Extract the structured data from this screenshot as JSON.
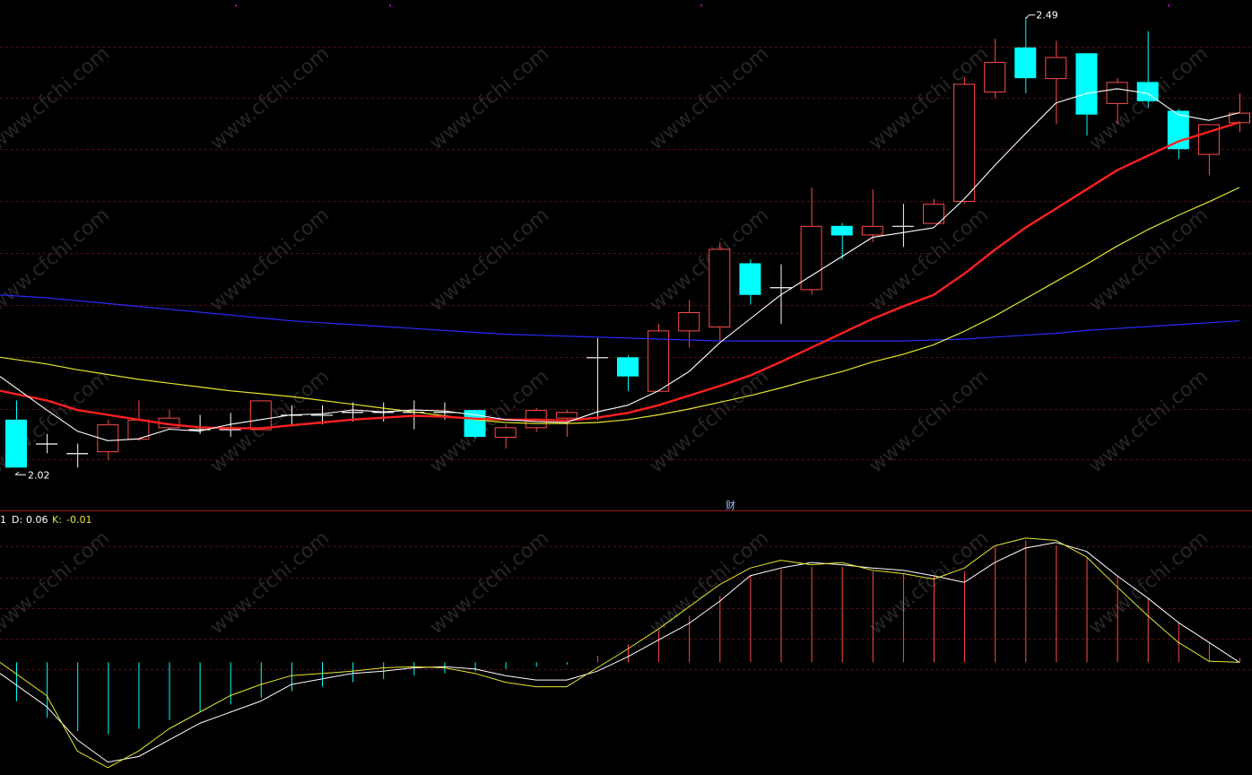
{
  "colors": {
    "background": "#000000",
    "grid": "#5a0c0c",
    "divider": "#9a1a1a",
    "up": "#ff4a4a",
    "down": "#00ffff",
    "neutral": "#ffffff",
    "ma5": "#ffffff",
    "ma10": "#ff2020",
    "ma20": "#e6e62c",
    "ma60": "#2a2aff",
    "k_line": "#e6e62c",
    "d_line": "#ffffff",
    "top_markers": "#c000c0"
  },
  "chart_data": [
    {
      "type": "candlestick",
      "panel": "price",
      "grid": true,
      "ylim": [
        1.995,
        2.5
      ],
      "candles": [
        {
          "o": 2.07,
          "h": 2.09,
          "l": 2.02,
          "c": 2.02
        },
        {
          "o": 2.045,
          "h": 2.055,
          "l": 2.035,
          "c": 2.045
        },
        {
          "o": 2.035,
          "h": 2.045,
          "l": 2.02,
          "c": 2.035
        },
        {
          "o": 2.037,
          "h": 2.07,
          "l": 2.028,
          "c": 2.065
        },
        {
          "o": 2.05,
          "h": 2.09,
          "l": 2.048,
          "c": 2.07
        },
        {
          "o": 2.062,
          "h": 2.08,
          "l": 2.06,
          "c": 2.072
        },
        {
          "o": 2.06,
          "h": 2.075,
          "l": 2.055,
          "c": 2.06
        },
        {
          "o": 2.06,
          "h": 2.077,
          "l": 2.052,
          "c": 2.06
        },
        {
          "o": 2.06,
          "h": 2.085,
          "l": 2.06,
          "c": 2.09
        },
        {
          "o": 2.075,
          "h": 2.085,
          "l": 2.065,
          "c": 2.075
        },
        {
          "o": 2.075,
          "h": 2.085,
          "l": 2.065,
          "c": 2.075
        },
        {
          "o": 2.078,
          "h": 2.088,
          "l": 2.068,
          "c": 2.078
        },
        {
          "o": 2.078,
          "h": 2.088,
          "l": 2.068,
          "c": 2.078
        },
        {
          "o": 2.078,
          "h": 2.09,
          "l": 2.06,
          "c": 2.078
        },
        {
          "o": 2.078,
          "h": 2.088,
          "l": 2.07,
          "c": 2.078
        },
        {
          "o": 2.08,
          "h": 2.08,
          "l": 2.05,
          "c": 2.052
        },
        {
          "o": 2.052,
          "h": 2.065,
          "l": 2.04,
          "c": 2.062
        },
        {
          "o": 2.062,
          "h": 2.082,
          "l": 2.057,
          "c": 2.08
        },
        {
          "o": 2.072,
          "h": 2.08,
          "l": 2.052,
          "c": 2.078
        },
        {
          "o": 2.135,
          "h": 2.155,
          "l": 2.07,
          "c": 2.135
        },
        {
          "o": 2.135,
          "h": 2.137,
          "l": 2.1,
          "c": 2.115
        },
        {
          "o": 2.1,
          "h": 2.17,
          "l": 2.1,
          "c": 2.163
        },
        {
          "o": 2.163,
          "h": 2.195,
          "l": 2.145,
          "c": 2.182
        },
        {
          "o": 2.167,
          "h": 2.255,
          "l": 2.152,
          "c": 2.248
        },
        {
          "o": 2.233,
          "h": 2.237,
          "l": 2.19,
          "c": 2.2
        },
        {
          "o": 2.208,
          "h": 2.232,
          "l": 2.17,
          "c": 2.208
        },
        {
          "o": 2.206,
          "h": 2.312,
          "l": 2.2,
          "c": 2.272
        },
        {
          "o": 2.272,
          "h": 2.275,
          "l": 2.237,
          "c": 2.262
        },
        {
          "o": 2.263,
          "h": 2.31,
          "l": 2.255,
          "c": 2.272
        },
        {
          "o": 2.272,
          "h": 2.295,
          "l": 2.25,
          "c": 2.272
        },
        {
          "o": 2.275,
          "h": 2.3,
          "l": 2.275,
          "c": 2.295
        },
        {
          "o": 2.298,
          "h": 2.427,
          "l": 2.295,
          "c": 2.42
        },
        {
          "o": 2.412,
          "h": 2.467,
          "l": 2.405,
          "c": 2.443
        },
        {
          "o": 2.458,
          "h": 2.49,
          "l": 2.41,
          "c": 2.426
        },
        {
          "o": 2.426,
          "h": 2.465,
          "l": 2.378,
          "c": 2.448
        },
        {
          "o": 2.452,
          "h": 2.452,
          "l": 2.366,
          "c": 2.388
        },
        {
          "o": 2.4,
          "h": 2.426,
          "l": 2.378,
          "c": 2.422
        },
        {
          "o": 2.422,
          "h": 2.475,
          "l": 2.395,
          "c": 2.402
        },
        {
          "o": 2.392,
          "h": 2.394,
          "l": 2.342,
          "c": 2.352
        },
        {
          "o": 2.347,
          "h": 2.378,
          "l": 2.325,
          "c": 2.378
        },
        {
          "o": 2.38,
          "h": 2.41,
          "l": 2.37,
          "c": 2.39
        }
      ],
      "series": [
        {
          "values": [
            2.115,
            2.08,
            2.058,
            2.048,
            2.05,
            2.06,
            2.058,
            2.065,
            2.07,
            2.075,
            2.076,
            2.08,
            2.078,
            2.08,
            2.079,
            2.075,
            2.07,
            2.068,
            2.067,
            2.078,
            2.085,
            2.1,
            2.12,
            2.15,
            2.175,
            2.2,
            2.22,
            2.24,
            2.26,
            2.265,
            2.27,
            2.3,
            2.335,
            2.368,
            2.4,
            2.41,
            2.415,
            2.41,
            2.388,
            2.382,
            2.39
          ]
        },
        {
          "values": [
            2.1,
            2.09,
            2.08,
            2.075,
            2.07,
            2.065,
            2.062,
            2.061,
            2.061,
            2.064,
            2.067,
            2.07,
            2.072,
            2.074,
            2.073,
            2.071,
            2.07,
            2.07,
            2.069,
            2.072,
            2.077,
            2.085,
            2.095,
            2.105,
            2.116,
            2.13,
            2.145,
            2.16,
            2.175,
            2.188,
            2.2,
            2.222,
            2.247,
            2.27,
            2.29,
            2.31,
            2.33,
            2.345,
            2.36,
            2.37,
            2.38
          ]
        },
        {
          "values": [
            2.135,
            2.128,
            2.122,
            2.117,
            2.112,
            2.108,
            2.104,
            2.1,
            2.097,
            2.094,
            2.09,
            2.086,
            2.082,
            2.078,
            2.074,
            2.07,
            2.067,
            2.066,
            2.066,
            2.067,
            2.07,
            2.075,
            2.081,
            2.088,
            2.095,
            2.103,
            2.112,
            2.12,
            2.13,
            2.138,
            2.148,
            2.162,
            2.178,
            2.196,
            2.214,
            2.232,
            2.251,
            2.268,
            2.283,
            2.297,
            2.312
          ]
        },
        {
          "values": [
            2.2,
            2.197,
            2.194,
            2.191,
            2.188,
            2.185,
            2.182,
            2.179,
            2.176,
            2.173,
            2.171,
            2.169,
            2.167,
            2.165,
            2.163,
            2.161,
            2.159,
            2.158,
            2.157,
            2.156,
            2.155,
            2.154,
            2.153,
            2.152,
            2.152,
            2.152,
            2.152,
            2.152,
            2.152,
            2.152,
            2.153,
            2.154,
            2.156,
            2.158,
            2.16,
            2.163,
            2.165,
            2.167,
            2.169,
            2.171,
            2.173
          ]
        }
      ],
      "annotations": {
        "high_label": "2.49",
        "low_label": "2.02"
      }
    },
    {
      "type": "macd",
      "panel": "indicator",
      "grid": true,
      "ylim": [
        -0.1,
        0.12
      ],
      "header": {
        "prefix": "1",
        "d_label": "D:",
        "d_value": "0.06",
        "k_label": "K:",
        "k_value": "-0.01"
      },
      "series": [
        {
          "name": "D",
          "values": [
            -0.01,
            -0.04,
            -0.07,
            -0.09,
            -0.085,
            -0.07,
            -0.055,
            -0.045,
            -0.035,
            -0.02,
            -0.015,
            -0.01,
            -0.008,
            -0.005,
            -0.004,
            -0.006,
            -0.012,
            -0.016,
            -0.016,
            -0.008,
            0.005,
            0.02,
            0.035,
            0.055,
            0.078,
            0.085,
            0.09,
            0.088,
            0.085,
            0.083,
            0.078,
            0.072,
            0.09,
            0.103,
            0.108,
            0.1,
            0.078,
            0.058,
            0.036,
            0.018,
            0.0
          ]
        },
        {
          "name": "K",
          "values": [
            0.0,
            -0.03,
            -0.08,
            -0.095,
            -0.08,
            -0.06,
            -0.045,
            -0.03,
            -0.02,
            -0.012,
            -0.01,
            -0.008,
            -0.005,
            -0.004,
            -0.005,
            -0.01,
            -0.018,
            -0.022,
            -0.022,
            -0.005,
            0.012,
            0.03,
            0.05,
            0.07,
            0.085,
            0.092,
            0.088,
            0.09,
            0.083,
            0.08,
            0.075,
            0.085,
            0.105,
            0.112,
            0.11,
            0.095,
            0.068,
            0.042,
            0.018,
            0.001,
            0.0
          ]
        },
        {
          "name": "hist",
          "values": [
            -0.035,
            -0.05,
            -0.062,
            -0.065,
            -0.06,
            -0.052,
            -0.045,
            -0.038,
            -0.032,
            -0.026,
            -0.022,
            -0.018,
            -0.015,
            -0.012,
            -0.01,
            -0.008,
            -0.006,
            -0.004,
            -0.002,
            0.006,
            0.016,
            0.028,
            0.042,
            0.06,
            0.078,
            0.084,
            0.086,
            0.086,
            0.082,
            0.08,
            0.078,
            0.082,
            0.104,
            0.11,
            0.105,
            0.095,
            0.078,
            0.058,
            0.036,
            0.018,
            0.004
          ]
        }
      ]
    }
  ],
  "panel_title": "财",
  "watermark": "www.cfchi.com"
}
